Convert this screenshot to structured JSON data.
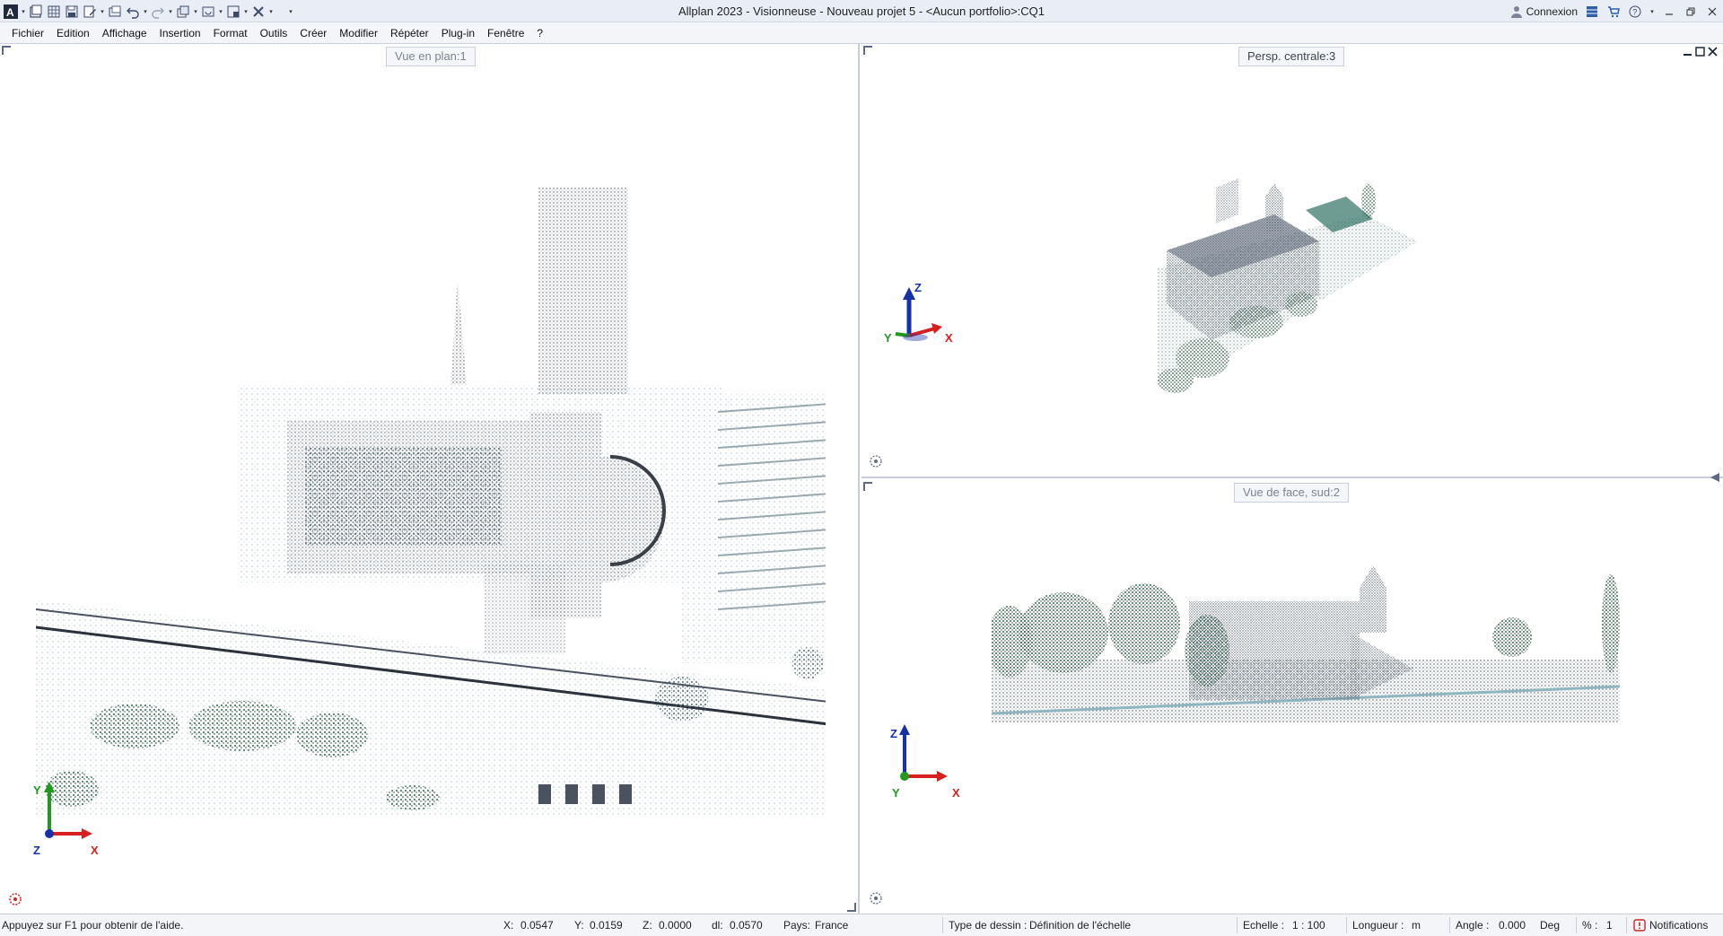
{
  "window": {
    "title": "Allplan 2023 - Visionneuse - Nouveau projet 5 - <Aucun portfolio>:CQ1",
    "connexion_label": "Connexion",
    "accent": "#e9eef6"
  },
  "menu": {
    "items": [
      "Fichier",
      "Edition",
      "Affichage",
      "Insertion",
      "Format",
      "Outils",
      "Créer",
      "Modifier",
      "Répéter",
      "Plug-in",
      "Fenêtre",
      "?"
    ]
  },
  "viewports": {
    "plan": {
      "label": "Vue en plan:1",
      "axis_y": "Y",
      "axis_x": "X",
      "axis_z": "Z"
    },
    "persp": {
      "label": "Persp. centrale:3",
      "axis_y": "Y",
      "axis_x": "X",
      "axis_z": "Z"
    },
    "face": {
      "label": "Vue de face, sud:2",
      "axis_y": "Y",
      "axis_x": "X",
      "axis_z": "Z"
    }
  },
  "status": {
    "help": "Appuyez sur F1 pour obtenir de l'aide.",
    "x_label": "X:",
    "x_value": "0.0547",
    "y_label": "Y:",
    "y_value": "0.0159",
    "z_label": "Z:",
    "z_value": "0.0000",
    "dl_label": "dl:",
    "dl_value": "0.0570",
    "pays_label": "Pays:",
    "pays_value": "France",
    "type_label": "Type de dessin :",
    "type_value": "Définition de l'échelle",
    "echelle_label": "Echelle :",
    "echelle_value": "1 : 100",
    "longueur_label": "Longueur :",
    "longueur_value": "m",
    "angle_label": "Angle :",
    "angle_value": "0.000",
    "angle_unit": "Deg",
    "pct_label": "% :",
    "pct_value": "1",
    "notifications": "Notifications"
  },
  "colors": {
    "axis_x": "#d62020",
    "axis_y": "#1f9a1f",
    "axis_z": "#1730a8"
  }
}
